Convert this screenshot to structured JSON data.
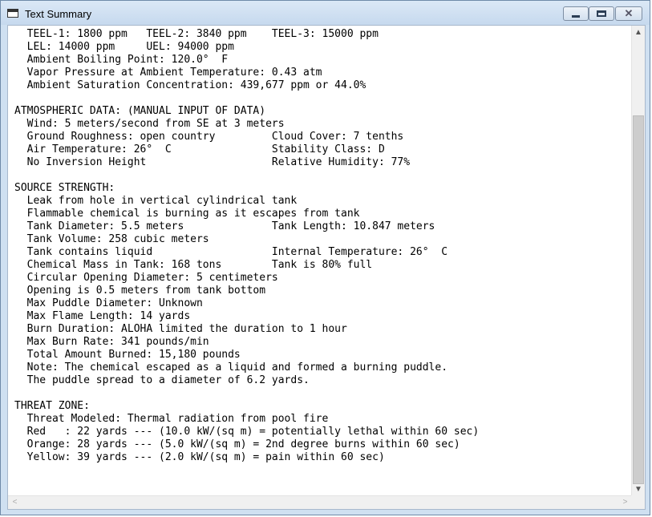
{
  "window": {
    "title": "Text Summary",
    "minimize_glyph": "",
    "maximize_glyph": "",
    "close_glyph": "✕"
  },
  "report": {
    "lines": [
      "  TEEL-1: 1800 ppm   TEEL-2: 3840 ppm    TEEL-3: 15000 ppm",
      "  LEL: 14000 ppm     UEL: 94000 ppm",
      "  Ambient Boiling Point: 120.0°  F",
      "  Vapor Pressure at Ambient Temperature: 0.43 atm",
      "  Ambient Saturation Concentration: 439,677 ppm or 44.0%",
      "",
      "ATMOSPHERIC DATA: (MANUAL INPUT OF DATA)",
      "  Wind: 5 meters/second from SE at 3 meters",
      "  Ground Roughness: open country         Cloud Cover: 7 tenths",
      "  Air Temperature: 26°  C                Stability Class: D",
      "  No Inversion Height                    Relative Humidity: 77%",
      "",
      "SOURCE STRENGTH:",
      "  Leak from hole in vertical cylindrical tank",
      "  Flammable chemical is burning as it escapes from tank",
      "  Tank Diameter: 5.5 meters              Tank Length: 10.847 meters",
      "  Tank Volume: 258 cubic meters",
      "  Tank contains liquid                   Internal Temperature: 26°  C",
      "  Chemical Mass in Tank: 168 tons        Tank is 80% full",
      "  Circular Opening Diameter: 5 centimeters",
      "  Opening is 0.5 meters from tank bottom",
      "  Max Puddle Diameter: Unknown",
      "  Max Flame Length: 14 yards",
      "  Burn Duration: ALOHA limited the duration to 1 hour",
      "  Max Burn Rate: 341 pounds/min",
      "  Total Amount Burned: 15,180 pounds",
      "  Note: The chemical escaped as a liquid and formed a burning puddle.",
      "  The puddle spread to a diameter of 6.2 yards.",
      "",
      "THREAT ZONE:",
      "  Threat Modeled: Thermal radiation from pool fire",
      "  Red   : 22 yards --- (10.0 kW/(sq m) = potentially lethal within 60 sec)",
      "  Orange: 28 yards --- (5.0 kW/(sq m) = 2nd degree burns within 60 sec)",
      "  Yellow: 39 yards --- (2.0 kW/(sq m) = pain within 60 sec)"
    ]
  },
  "scrollbars": {
    "up_arrow": "▲",
    "down_arrow": "▼",
    "left_arrow": "<",
    "right_arrow": ">"
  }
}
